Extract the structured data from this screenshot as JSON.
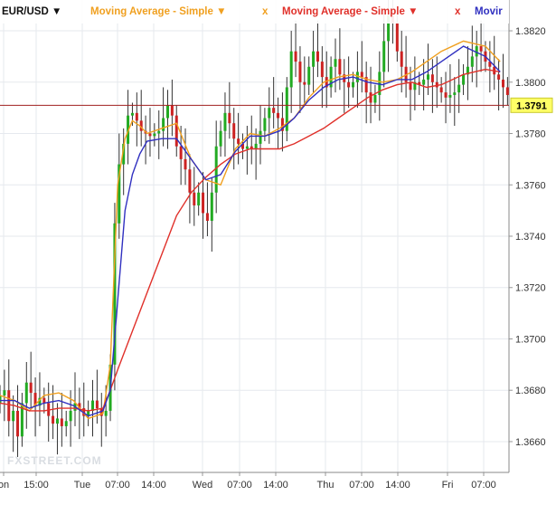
{
  "toolbar": {
    "symbol": "EUR/USD",
    "dropdown_glyph": "▼",
    "remove_glyph": "x",
    "indicators": [
      {
        "label": "Moving Average - Simple",
        "color": "#f0a020"
      },
      {
        "label": "Moving Average - Simple",
        "color": "#e0302a"
      },
      {
        "label": "Movir",
        "color": "#3030c0"
      }
    ]
  },
  "watermark": "FXSTREET.COM",
  "colors": {
    "up_candle": "#22aa22",
    "down_candle": "#cc2222",
    "wick": "#333333",
    "grid": "#e6e9ee",
    "price_line": "#a02020",
    "price_label_bg": "#ffff66"
  },
  "chart_data": {
    "type": "candlestick",
    "symbol": "EUR/USD",
    "ylim": [
      1.3648,
      1.3832
    ],
    "y_ticks": [
      "1.3660",
      "1.3680",
      "1.3700",
      "1.3720",
      "1.3740",
      "1.3760",
      "1.3780",
      "1.3800",
      "1.3820"
    ],
    "x_ticks": [
      "on",
      "15:00",
      "Tue",
      "07:00",
      "14:00",
      "Wed",
      "07:00",
      "14:00",
      "Thu",
      "07:00",
      "14:00",
      "Fri",
      "07:00"
    ],
    "current_price": "1.3791",
    "series": [
      {
        "name": "Moving Average - Simple",
        "color": "#f0a020",
        "x": [
          0,
          10,
          20,
          30,
          40,
          50,
          60,
          70,
          75,
          80,
          85,
          90,
          95,
          100,
          110,
          120,
          130,
          140,
          150,
          160,
          170,
          180,
          190,
          200,
          210,
          220,
          230,
          240,
          250,
          260,
          270,
          280,
          290,
          300,
          315,
          330,
          340
        ],
        "y": [
          1.3678,
          1.3676,
          1.3672,
          1.3678,
          1.3679,
          1.3676,
          1.3669,
          1.3671,
          1.369,
          1.376,
          1.3778,
          1.3785,
          1.3783,
          1.378,
          1.3782,
          1.3784,
          1.377,
          1.3762,
          1.376,
          1.3774,
          1.378,
          1.3779,
          1.3782,
          1.3786,
          1.3794,
          1.38,
          1.3802,
          1.3803,
          1.3801,
          1.38,
          1.3801,
          1.3804,
          1.3808,
          1.3812,
          1.3816,
          1.3814,
          1.3808
        ]
      },
      {
        "name": "Moving Average - Simple",
        "color": "#e0302a",
        "x": [
          0,
          10,
          20,
          30,
          40,
          50,
          60,
          70,
          75,
          80,
          90,
          100,
          110,
          120,
          130,
          140,
          150,
          160,
          170,
          180,
          190,
          200,
          210,
          220,
          230,
          240,
          250,
          260,
          270,
          280,
          290,
          300,
          315,
          330,
          340
        ],
        "y": [
          1.3675,
          1.3674,
          1.3672,
          1.3672,
          1.3673,
          1.3673,
          1.3672,
          1.3673,
          1.368,
          1.3688,
          1.3703,
          1.3718,
          1.3733,
          1.3748,
          1.3757,
          1.3763,
          1.3768,
          1.3772,
          1.3774,
          1.3774,
          1.3774,
          1.3776,
          1.3779,
          1.3782,
          1.3786,
          1.379,
          1.3794,
          1.3797,
          1.3799,
          1.38,
          1.3798,
          1.3799,
          1.3803,
          1.3805,
          1.3804
        ]
      },
      {
        "name": "Movir",
        "color": "#3030c0",
        "x": [
          0,
          10,
          20,
          30,
          40,
          50,
          60,
          70,
          75,
          80,
          85,
          90,
          95,
          100,
          110,
          120,
          130,
          140,
          150,
          160,
          170,
          180,
          190,
          200,
          210,
          220,
          230,
          240,
          250,
          260,
          270,
          280,
          290,
          300,
          315,
          330,
          340
        ],
        "y": [
          1.3676,
          1.3676,
          1.3673,
          1.3675,
          1.3676,
          1.3674,
          1.367,
          1.3672,
          1.368,
          1.3715,
          1.375,
          1.3764,
          1.3772,
          1.3777,
          1.3778,
          1.3778,
          1.377,
          1.3762,
          1.3764,
          1.3773,
          1.3779,
          1.3779,
          1.3781,
          1.3786,
          1.3793,
          1.3798,
          1.3801,
          1.3802,
          1.38,
          1.3799,
          1.3801,
          1.3801,
          1.3804,
          1.3808,
          1.3814,
          1.381,
          1.3804
        ]
      }
    ],
    "candles_outline": {
      "x": [
        0,
        3,
        6,
        9,
        12,
        15,
        18,
        21,
        24,
        27,
        30,
        33,
        36,
        39,
        42,
        45,
        48,
        51,
        54,
        57,
        60,
        63,
        66,
        69,
        72,
        75,
        78,
        81,
        84,
        87,
        90,
        93,
        96,
        99,
        102,
        105,
        108,
        111,
        114,
        117,
        120,
        123,
        126,
        129,
        132,
        135,
        138,
        141,
        144,
        147,
        150,
        153,
        156,
        159,
        162,
        165,
        168,
        171,
        174,
        177,
        180,
        183,
        186,
        189,
        192,
        195,
        198,
        201,
        204,
        207,
        210,
        213,
        216,
        219,
        222,
        225,
        228,
        231,
        234,
        237,
        240,
        243,
        246,
        249,
        252,
        255,
        258,
        261,
        264,
        267,
        270,
        273,
        276,
        279,
        282,
        285,
        288,
        291,
        294,
        297,
        300,
        303,
        306,
        309,
        312,
        315,
        318,
        321,
        324,
        327,
        330,
        333,
        336,
        339,
        342,
        345
      ],
      "close": [
        1.3678,
        1.368,
        1.3668,
        1.3672,
        1.3662,
        1.3675,
        1.3683,
        1.3679,
        1.3674,
        1.3677,
        1.3675,
        1.367,
        1.3667,
        1.3669,
        1.3666,
        1.3668,
        1.3672,
        1.3675,
        1.3673,
        1.367,
        1.3672,
        1.3676,
        1.3673,
        1.367,
        1.3672,
        1.369,
        1.3745,
        1.3768,
        1.3776,
        1.3787,
        1.3788,
        1.3785,
        1.3781,
        1.378,
        1.3779,
        1.378,
        1.3781,
        1.3786,
        1.3791,
        1.3787,
        1.3775,
        1.377,
        1.3766,
        1.3757,
        1.3752,
        1.3757,
        1.3749,
        1.3746,
        1.3757,
        1.3775,
        1.3781,
        1.3788,
        1.3784,
        1.3778,
        1.3776,
        1.3774,
        1.3775,
        1.3774,
        1.3776,
        1.3781,
        1.3786,
        1.379,
        1.3788,
        1.3786,
        1.3781,
        1.3798,
        1.3812,
        1.3808,
        1.38,
        1.3799,
        1.3806,
        1.3812,
        1.3808,
        1.3802,
        1.3798,
        1.3806,
        1.3809,
        1.3803,
        1.38,
        1.3798,
        1.38,
        1.3804,
        1.3802,
        1.3796,
        1.3792,
        1.3795,
        1.3804,
        1.3816,
        1.3826,
        1.3823,
        1.3812,
        1.3806,
        1.38,
        1.3797,
        1.38,
        1.3799,
        1.3801,
        1.3803,
        1.38,
        1.3798,
        1.3796,
        1.3794,
        1.3795,
        1.3796,
        1.3799,
        1.3803,
        1.3806,
        1.381,
        1.3814,
        1.3812,
        1.3808,
        1.3806,
        1.3803,
        1.3801,
        1.3798,
        1.3795
      ]
    }
  }
}
